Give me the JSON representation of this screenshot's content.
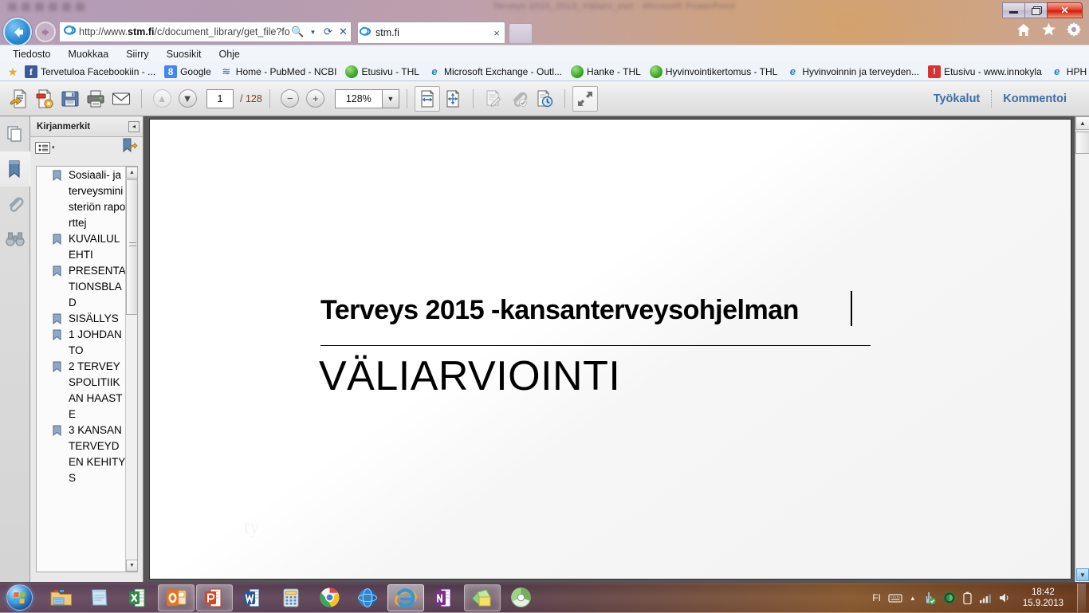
{
  "window": {
    "background_title": "Terveys 2015_2013_Väliarv_esit  -  Microsoft PowerPoint",
    "minimize_label": "Pienennä",
    "restore_label": "Palauta",
    "close_label": "Sulje"
  },
  "browser": {
    "back_label": "Takaisin",
    "forward_label": "Eteenpäin",
    "address": {
      "protocol": "http://www.",
      "domain": "stm.fi",
      "path": "/c/document_library/get_file?fold",
      "favicon": "ie-icon",
      "search_icon": "search-icon",
      "refresh_icon": "refresh-icon",
      "stop_icon": "stop-icon"
    },
    "tab": {
      "label": "stm.fi",
      "close": "×",
      "favicon": "ie-icon"
    },
    "new_tab_label": "Uusi välilehti",
    "command_icons": [
      {
        "name": "home-icon",
        "glyph": "⌂"
      },
      {
        "name": "favorites-star-icon",
        "glyph": "★"
      },
      {
        "name": "gear-settings-icon",
        "glyph": "⚙"
      }
    ],
    "menu": [
      {
        "label": "Tiedosto",
        "accel": "T"
      },
      {
        "label": "Muokkaa",
        "accel": "M"
      },
      {
        "label": "Siirry",
        "accel": "r"
      },
      {
        "label": "Suosikit",
        "accel": "S"
      },
      {
        "label": "Ohje",
        "accel": "e"
      }
    ],
    "favorites": [
      {
        "label": "Tervetuloa Facebookiin - ...",
        "icon": "facebook-icon",
        "glyph": "f"
      },
      {
        "label": "Google",
        "icon": "google-icon",
        "glyph": "8"
      },
      {
        "label": "Home - PubMed - NCBI",
        "icon": "pubmed-icon",
        "glyph": "≋"
      },
      {
        "label": "Etusivu - THL",
        "icon": "thl-globe-icon",
        "glyph": ""
      },
      {
        "label": "Microsoft Exchange - Outl...",
        "icon": "ie-page-icon",
        "glyph": "e"
      },
      {
        "label": "Hanke - THL",
        "icon": "thl-globe-icon",
        "glyph": ""
      },
      {
        "label": "Hyvinvointikertomus - THL",
        "icon": "thl-globe-icon",
        "glyph": ""
      },
      {
        "label": "Hyvinvoinnin ja terveyden...",
        "icon": "ie-page-icon",
        "glyph": "e"
      },
      {
        "label": "Etusivu - www.innokyla",
        "icon": "innokyla-icon",
        "glyph": "!"
      },
      {
        "label": "HPH",
        "icon": "ie-page-icon",
        "glyph": "e"
      }
    ],
    "favorites_star_icon": "favorites-star-icon"
  },
  "pdf_toolbar": {
    "buttons": [
      {
        "name": "save-as-other-icon",
        "glyph": "↩"
      },
      {
        "name": "export-pdf-icon",
        "glyph": "⚙"
      },
      {
        "name": "save-file-icon",
        "glyph": "὚b"
      },
      {
        "name": "print-icon",
        "glyph": "⎙"
      },
      {
        "name": "email-icon",
        "glyph": "✉"
      }
    ],
    "prev_page_label": "▲",
    "next_page_label": "▼",
    "page_number": "1",
    "page_total": "/ 128",
    "zoom_out_label": "−",
    "zoom_in_label": "+",
    "zoom_level": "128%",
    "zoom_dropdown": "▼",
    "view_buttons": [
      {
        "name": "fit-width-icon",
        "glyph": "⬌"
      },
      {
        "name": "fit-page-icon",
        "glyph": "⬍"
      }
    ],
    "annotation_buttons": [
      {
        "name": "sign-icon",
        "glyph": "✎"
      },
      {
        "name": "attachment-icon",
        "glyph": "Ὄe"
      },
      {
        "name": "history-icon",
        "glyph": "ὕ4"
      }
    ],
    "fullscreen_icon": "fullscreen-icon",
    "tools_label": "Työkalut",
    "comment_label": "Kommentoi"
  },
  "rail": [
    {
      "name": "page-thumbnails-icon",
      "glyph": "❐"
    },
    {
      "name": "bookmarks-icon",
      "glyph": "⚑"
    },
    {
      "name": "attachments-icon",
      "glyph": "Ὄe"
    },
    {
      "name": "search-binoculars-icon",
      "glyph": "☷"
    }
  ],
  "bookmarks_panel": {
    "title": "Kirjanmerkit",
    "collapse_glyph": "◂",
    "options_glyph": "≡",
    "options_caret": "▾",
    "expand_icon": "expand-bookmarks-icon",
    "items": [
      "Sosiaali- ja terveysministeriön raporttej",
      "KUVAILULEHTI",
      "PRESENTATIONSBLAD",
      "SISÄLLYS",
      "1 JOHDANTO",
      "2 TERVEYSPOLITIIKAN HAASTE",
      "3 KANSANTERVEYDEN KEHITYS"
    ],
    "scroll_up_glyph": "▲",
    "scroll_down_glyph": "▼"
  },
  "document": {
    "title": "Terveys 2015 -kansanterveysohjelman",
    "subtitle": "VÄLIARVIOINTI",
    "ghost_text": "ty"
  },
  "viewport_scrollbar": {
    "up_glyph": "▲",
    "down_glyph": "▼",
    "fit_glyph": "▼"
  },
  "taskbar": {
    "start_label": "Käynnistä",
    "items": [
      {
        "name": "taskbar-explorer",
        "label": "Resurssienhallinta",
        "state": "pinned"
      },
      {
        "name": "taskbar-notepad",
        "label": "Muistio",
        "state": "pinned"
      },
      {
        "name": "taskbar-excel",
        "label": "Microsoft Excel",
        "state": "pinned"
      },
      {
        "name": "taskbar-outlook",
        "label": "Microsoft Outlook",
        "state": "running"
      },
      {
        "name": "taskbar-powerpoint",
        "label": "Microsoft PowerPoint",
        "state": "running"
      },
      {
        "name": "taskbar-word",
        "label": "Microsoft Word",
        "state": "pinned"
      },
      {
        "name": "taskbar-calculator",
        "label": "Laskin",
        "state": "pinned"
      },
      {
        "name": "taskbar-chrome",
        "label": "Google Chrome",
        "state": "pinned"
      },
      {
        "name": "taskbar-firefox",
        "label": "Selain",
        "state": "pinned"
      },
      {
        "name": "taskbar-internet-explorer",
        "label": "Internet Explorer",
        "state": "active"
      },
      {
        "name": "taskbar-onenote",
        "label": "Microsoft OneNote",
        "state": "pinned"
      },
      {
        "name": "taskbar-stickynotes",
        "label": "Muistilaput",
        "state": "running"
      },
      {
        "name": "taskbar-mediaplayer",
        "label": "Soitin",
        "state": "pinned"
      }
    ],
    "tray": {
      "language": "FI",
      "items": [
        {
          "name": "keyboard-icon",
          "glyph": "⌨"
        },
        {
          "name": "show-hidden-icons-icon",
          "glyph": "▲"
        },
        {
          "name": "usb-safely-remove-icon",
          "glyph": "✓"
        },
        {
          "name": "antivirus-icon",
          "glyph": "●"
        },
        {
          "name": "battery-icon",
          "glyph": "▯"
        },
        {
          "name": "network-signal-icon",
          "glyph": "▆"
        },
        {
          "name": "volume-icon",
          "glyph": "ὐa"
        }
      ],
      "time": "18:42",
      "date": "15.9.2013"
    },
    "show_desktop_label": "Näytä työpöytä"
  },
  "colors": {
    "ie_blue": "#1a7fc1",
    "pdf_link_blue": "#3b6ea5",
    "page_total_brown": "#7a3d20",
    "taskbar": "#3a2838"
  }
}
